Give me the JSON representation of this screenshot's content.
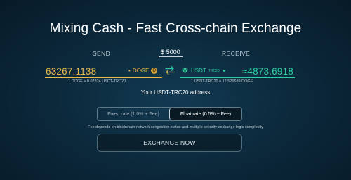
{
  "page": {
    "title": "Mixing Cash - Fast Cross-chain Exchange"
  },
  "exchange": {
    "send_label": "SEND",
    "receive_label": "RECEIVE",
    "usd_value": "$ 5000",
    "send": {
      "amount": "63267.1138",
      "currency": "DOGE",
      "currency_prefix": "•",
      "icon_glyph": "Đ",
      "icon": "doge-coin-icon",
      "rate": "1 DOGE ≈ 0.07824 USDT-TRC20",
      "color": "#e9b84a"
    },
    "receive": {
      "amount": "≈4873.6918",
      "currency": "USDT",
      "currency_sup": "TRC20",
      "icon": "tether-gem-icon",
      "rate": "1 USDT-TRC20 ≈ 12.526689 DOGE",
      "color": "#2ecf9d"
    },
    "swap_icon": "swap-arrows-icon",
    "address_label": "Your USDT-TRC20 address",
    "rate_options": [
      {
        "label": "Fixed rate (1.0% + Fee)",
        "selected": false
      },
      {
        "label": "Float rate (0.5% + Fee)",
        "selected": true
      }
    ],
    "fee_note": "Fee depends on blockchain network congestion status and multiple security exchange logic complexity",
    "exchange_button": "EXCHANGE NOW"
  }
}
